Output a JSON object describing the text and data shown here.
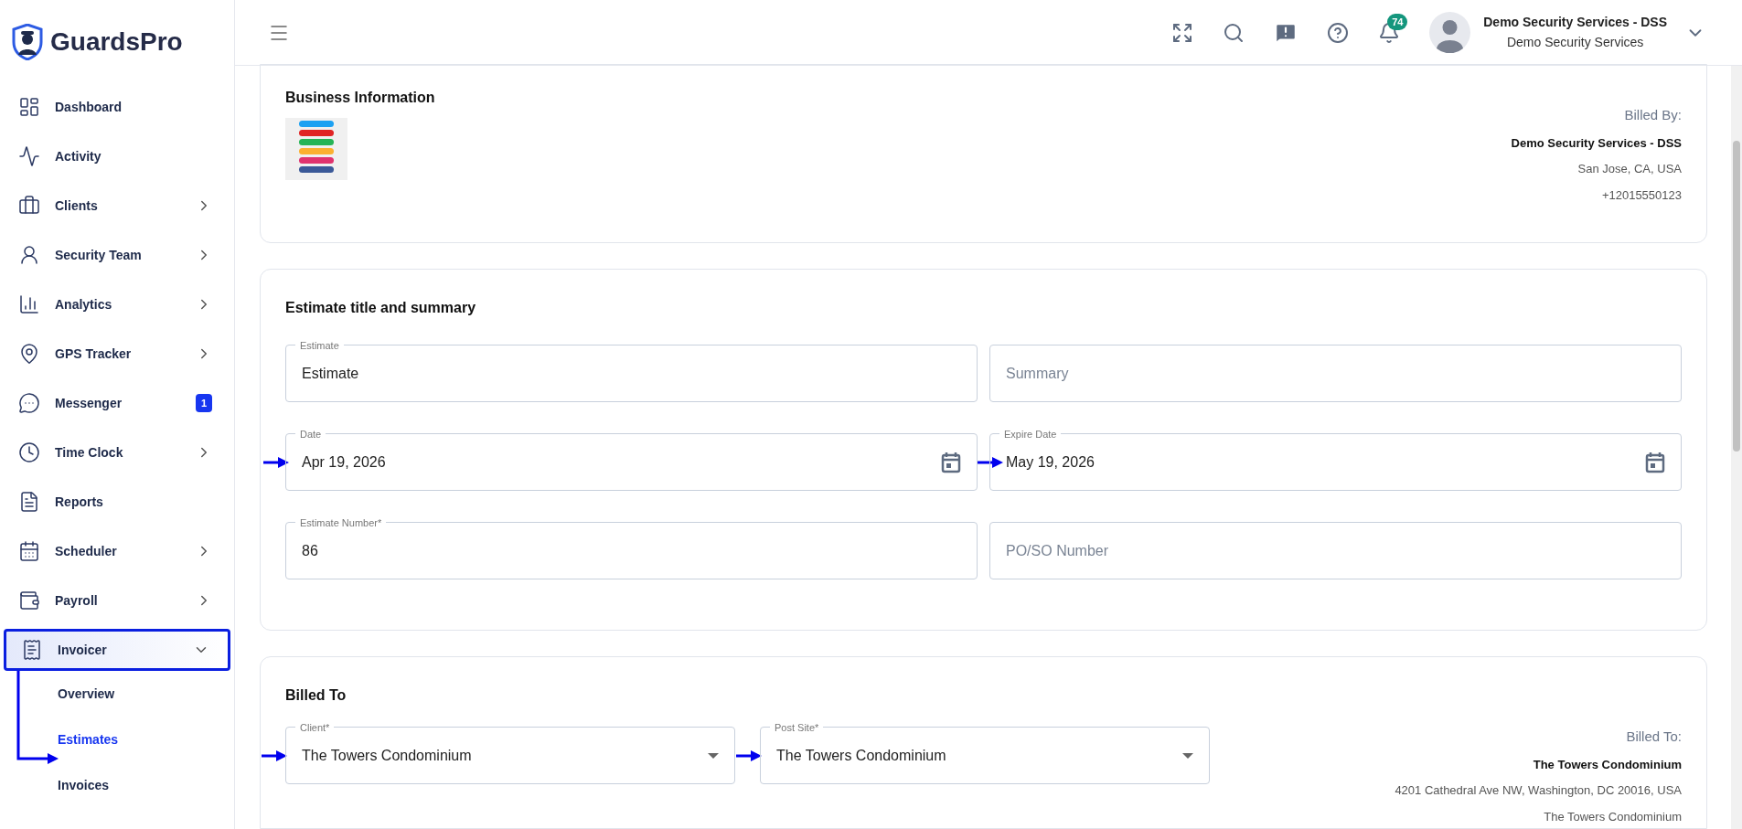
{
  "logo": {
    "text": "GuardsPro"
  },
  "sidebar": {
    "items": [
      {
        "label": "Dashboard",
        "expandable": false,
        "selected": false
      },
      {
        "label": "Activity",
        "expandable": false,
        "selected": false
      },
      {
        "label": "Clients",
        "expandable": true,
        "selected": false
      },
      {
        "label": "Security Team",
        "expandable": true,
        "selected": false
      },
      {
        "label": "Analytics",
        "expandable": true,
        "selected": false
      },
      {
        "label": "GPS Tracker",
        "expandable": true,
        "selected": false
      },
      {
        "label": "Messenger",
        "expandable": false,
        "selected": false,
        "badge": "1"
      },
      {
        "label": "Time Clock",
        "expandable": true,
        "selected": false
      },
      {
        "label": "Reports",
        "expandable": false,
        "selected": false
      },
      {
        "label": "Scheduler",
        "expandable": true,
        "selected": false
      },
      {
        "label": "Payroll",
        "expandable": true,
        "selected": false
      },
      {
        "label": "Invoicer",
        "expandable": true,
        "selected": false,
        "expanded": true,
        "children": [
          {
            "label": "Overview",
            "selected": false
          },
          {
            "label": "Estimates",
            "selected": true
          },
          {
            "label": "Invoices",
            "selected": false
          }
        ]
      }
    ]
  },
  "topbar": {
    "notification_count": "74",
    "user": {
      "name": "Demo Security Services - DSS",
      "company": "Demo Security Services"
    }
  },
  "business_info": {
    "title": "Business Information",
    "billed_by": {
      "label": "Billed By:",
      "name": "Demo Security Services - DSS",
      "address": "San Jose, CA, USA",
      "phone": "+12015550123"
    }
  },
  "estimate_summary": {
    "title": "Estimate title and summary",
    "fields": [
      {
        "kind": "text",
        "label": "Estimate",
        "value": "Estimate"
      },
      {
        "kind": "text",
        "placeholder": "Summary"
      },
      {
        "kind": "date",
        "label": "Date",
        "value": "Apr 19, 2026"
      },
      {
        "kind": "date",
        "label": "Expire Date",
        "value": "May 19, 2026"
      },
      {
        "kind": "text",
        "label": "Estimate Number*",
        "value": "86"
      },
      {
        "kind": "text",
        "placeholder": "PO/SO Number"
      }
    ]
  },
  "billed_to": {
    "title": "Billed To",
    "fields": [
      {
        "kind": "select",
        "label": "Client*",
        "value": "The Towers Condominium"
      },
      {
        "kind": "select",
        "label": "Post Site*",
        "value": "The Towers Condominium"
      }
    ],
    "details": {
      "label": "Billed To:",
      "name": "The Towers Condominium",
      "address": "4201 Cathedral Ave NW, Washington, DC 20016, USA",
      "note": "The Towers Condominium"
    }
  }
}
